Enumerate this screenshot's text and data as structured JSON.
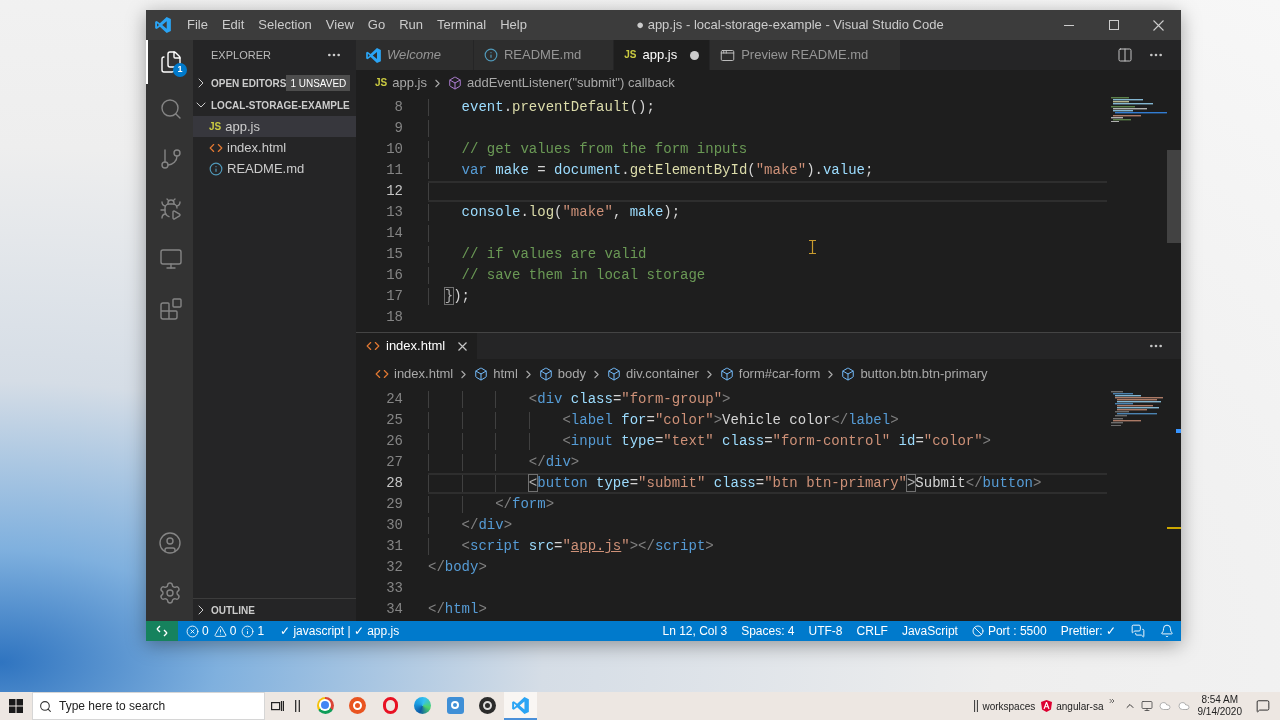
{
  "window": {
    "title": "● app.js - local-storage-example - Visual Studio Code"
  },
  "menu": [
    "File",
    "Edit",
    "Selection",
    "View",
    "Go",
    "Run",
    "Terminal",
    "Help"
  ],
  "activity_bar": [
    {
      "selected": true,
      "badge": "1"
    },
    {
      "selected": false
    },
    {
      "selected": false
    },
    {
      "selected": false
    },
    {
      "selected": false
    },
    {
      "selected": false
    }
  ],
  "sidebar": {
    "title": "EXPLORER",
    "sections": [
      {
        "title": "OPEN EDITORS",
        "expanded": false,
        "badge": "1 UNSAVED"
      },
      {
        "title": "LOCAL-STORAGE-EXAMPLE",
        "expanded": true,
        "files": [
          {
            "name": "app.js",
            "kind": "js",
            "icon_text": "JS",
            "selected": true
          },
          {
            "name": "index.html",
            "kind": "html",
            "selected": false
          },
          {
            "name": "README.md",
            "kind": "info",
            "selected": false
          }
        ]
      },
      {
        "title": "OUTLINE",
        "expanded": false
      }
    ]
  },
  "editor_groups": [
    {
      "tabs": [
        {
          "label": "Welcome",
          "kind": "welcome",
          "selected": false,
          "preview": true,
          "dirty": false
        },
        {
          "label": "README.md",
          "kind": "info",
          "selected": false,
          "preview": false,
          "dirty": false
        },
        {
          "label": "app.js",
          "kind": "js",
          "icon_text": "JS",
          "selected": true,
          "preview": false,
          "dirty": true
        },
        {
          "label": "Preview README.md",
          "kind": "preview",
          "selected": false,
          "preview": false,
          "dirty": false
        }
      ],
      "breadcrumb": [
        {
          "label": "app.js",
          "kind": "js",
          "icon_text": "JS"
        },
        {
          "label": "addEventListener(\"submit\") callback",
          "kind": "symbol"
        }
      ],
      "lines": [
        {
          "number": "8",
          "current": false,
          "tokens": [
            {
              "text": "    event",
              "kind": "variable"
            },
            {
              "text": ".",
              "kind": "punct"
            },
            {
              "text": "preventDefault",
              "kind": "function"
            },
            {
              "text": "();",
              "kind": "punct"
            }
          ]
        },
        {
          "number": "9",
          "current": false
        },
        {
          "number": "10",
          "current": false,
          "tokens": [
            {
              "text": "    // get values from the form inputs",
              "kind": "comment"
            }
          ]
        },
        {
          "number": "11",
          "current": false,
          "tokens": [
            {
              "text": "    var",
              "kind": "keyword"
            },
            {
              "text": " make",
              "kind": "variable"
            },
            {
              "text": " = ",
              "kind": "punct"
            },
            {
              "text": "document",
              "kind": "variable"
            },
            {
              "text": ".",
              "kind": "punct"
            },
            {
              "text": "getElementById",
              "kind": "function"
            },
            {
              "text": "(",
              "kind": "punct"
            },
            {
              "text": "\"make\"",
              "kind": "string"
            },
            {
              "text": ").",
              "kind": "punct"
            },
            {
              "text": "value",
              "kind": "variable"
            },
            {
              "text": ";",
              "kind": "punct"
            }
          ]
        },
        {
          "number": "12",
          "current": true
        },
        {
          "number": "13",
          "current": false,
          "tokens": [
            {
              "text": "    console",
              "kind": "variable"
            },
            {
              "text": ".",
              "kind": "punct"
            },
            {
              "text": "log",
              "kind": "function"
            },
            {
              "text": "(",
              "kind": "punct"
            },
            {
              "text": "\"make\"",
              "kind": "string"
            },
            {
              "text": ", ",
              "kind": "punct"
            },
            {
              "text": "make",
              "kind": "variable"
            },
            {
              "text": ");",
              "kind": "punct"
            }
          ]
        },
        {
          "number": "14",
          "current": false
        },
        {
          "number": "15",
          "current": false,
          "tokens": [
            {
              "text": "    // if values are valid",
              "kind": "comment"
            }
          ]
        },
        {
          "number": "16",
          "current": false,
          "tokens": [
            {
              "text": "    // save them in local storage",
              "kind": "comment"
            }
          ]
        },
        {
          "number": "17",
          "current": false,
          "tokens": [
            {
              "text": "  }",
              "kind": "match"
            },
            {
              "text": ");",
              "kind": "punct"
            }
          ]
        },
        {
          "number": "18",
          "current": false
        }
      ]
    },
    {
      "tabs": [
        {
          "label": "index.html",
          "kind": "html",
          "selected": true,
          "preview": false,
          "dirty": false
        }
      ],
      "breadcrumb": [
        {
          "label": "index.html",
          "kind": "html"
        },
        {
          "label": "html",
          "kind": "element"
        },
        {
          "label": "body",
          "kind": "element"
        },
        {
          "label": "div.container",
          "kind": "element"
        },
        {
          "label": "form#car-form",
          "kind": "element"
        },
        {
          "label": "button.btn.btn-primary",
          "kind": "element"
        }
      ],
      "lines": [
        {
          "number": "24",
          "current": false,
          "tokens": [
            {
              "text": "            <",
              "kind": "bracket"
            },
            {
              "text": "div",
              "kind": "tag"
            },
            {
              "text": " class",
              "kind": "attr"
            },
            {
              "text": "=",
              "kind": "punct"
            },
            {
              "text": "\"form-group\"",
              "kind": "string"
            },
            {
              "text": ">",
              "kind": "bracket"
            }
          ]
        },
        {
          "number": "25",
          "current": false,
          "tokens": [
            {
              "text": "                <",
              "kind": "bracket"
            },
            {
              "text": "label",
              "kind": "tag"
            },
            {
              "text": " for",
              "kind": "attr"
            },
            {
              "text": "=",
              "kind": "punct"
            },
            {
              "text": "\"color\"",
              "kind": "string"
            },
            {
              "text": ">",
              "kind": "bracket"
            },
            {
              "text": "Vehicle color",
              "kind": "text"
            },
            {
              "text": "</",
              "kind": "bracket"
            },
            {
              "text": "label",
              "kind": "tag"
            },
            {
              "text": ">",
              "kind": "bracket"
            }
          ]
        },
        {
          "number": "26",
          "current": false,
          "tokens": [
            {
              "text": "                <",
              "kind": "bracket"
            },
            {
              "text": "input",
              "kind": "tag"
            },
            {
              "text": " type",
              "kind": "attr"
            },
            {
              "text": "=",
              "kind": "punct"
            },
            {
              "text": "\"text\"",
              "kind": "string"
            },
            {
              "text": " class",
              "kind": "attr"
            },
            {
              "text": "=",
              "kind": "punct"
            },
            {
              "text": "\"form-control\"",
              "kind": "string"
            },
            {
              "text": " id",
              "kind": "attr"
            },
            {
              "text": "=",
              "kind": "punct"
            },
            {
              "text": "\"color\"",
              "kind": "string"
            },
            {
              "text": ">",
              "kind": "bracket"
            }
          ]
        },
        {
          "number": "27",
          "current": false,
          "tokens": [
            {
              "text": "            </",
              "kind": "bracket"
            },
            {
              "text": "div",
              "kind": "tag"
            },
            {
              "text": ">",
              "kind": "bracket"
            }
          ]
        },
        {
          "number": "28",
          "current": true,
          "tokens": [
            {
              "text": "            <",
              "kind": "match"
            },
            {
              "text": "button",
              "kind": "tag"
            },
            {
              "text": " type",
              "kind": "attr"
            },
            {
              "text": "=",
              "kind": "punct"
            },
            {
              "text": "\"submit\"",
              "kind": "string"
            },
            {
              "text": " class",
              "kind": "attr"
            },
            {
              "text": "=",
              "kind": "punct"
            },
            {
              "text": "\"btn btn-primary\"",
              "kind": "string"
            },
            {
              "text": ">",
              "kind": "match"
            },
            {
              "text": "Submit",
              "kind": "text"
            },
            {
              "text": "</",
              "kind": "bracket"
            },
            {
              "text": "button",
              "kind": "tag"
            },
            {
              "text": ">",
              "kind": "bracket"
            }
          ]
        },
        {
          "number": "29",
          "current": false,
          "tokens": [
            {
              "text": "        </",
              "kind": "bracket"
            },
            {
              "text": "form",
              "kind": "tag"
            },
            {
              "text": ">",
              "kind": "bracket"
            }
          ]
        },
        {
          "number": "30",
          "current": false,
          "tokens": [
            {
              "text": "    </",
              "kind": "bracket"
            },
            {
              "text": "div",
              "kind": "tag"
            },
            {
              "text": ">",
              "kind": "bracket"
            }
          ]
        },
        {
          "number": "31",
          "current": false,
          "tokens": [
            {
              "text": "    <",
              "kind": "bracket"
            },
            {
              "text": "script",
              "kind": "tag"
            },
            {
              "text": " src",
              "kind": "attr"
            },
            {
              "text": "=",
              "kind": "punct"
            },
            {
              "text": "\"",
              "kind": "string"
            },
            {
              "text": "app.js",
              "kind": "link"
            },
            {
              "text": "\"",
              "kind": "string"
            },
            {
              "text": ">",
              "kind": "bracket"
            },
            {
              "text": "</",
              "kind": "bracket"
            },
            {
              "text": "script",
              "kind": "tag"
            },
            {
              "text": ">",
              "kind": "bracket"
            }
          ]
        },
        {
          "number": "32",
          "current": false,
          "tokens": [
            {
              "text": "</",
              "kind": "bracket"
            },
            {
              "text": "body",
              "kind": "tag"
            },
            {
              "text": ">",
              "kind": "bracket"
            }
          ]
        },
        {
          "number": "33",
          "current": false
        },
        {
          "number": "34",
          "current": false,
          "tokens": [
            {
              "text": "</",
              "kind": "bracket"
            },
            {
              "text": "html",
              "kind": "tag"
            },
            {
              "text": ">",
              "kind": "bracket"
            }
          ]
        }
      ]
    }
  ],
  "status_bar": {
    "problems": {
      "errors": "0",
      "warnings": "0",
      "infos": "1"
    },
    "lint": "✓ javascript | ✓ app.js",
    "items": [
      {
        "kind": "text",
        "label": "Ln 12, Col 3"
      },
      {
        "kind": "text",
        "label": "Spaces: 4"
      },
      {
        "kind": "text",
        "label": "UTF-8"
      },
      {
        "kind": "text",
        "label": "CRLF"
      },
      {
        "kind": "text",
        "label": "JavaScript"
      },
      {
        "kind": "port",
        "label": "Port : 5500"
      },
      {
        "kind": "text",
        "label": "Prettier: ✓"
      }
    ]
  },
  "taskbar": {
    "search": {
      "placeholder": "Type here to search"
    },
    "apps": [
      {
        "selected": false
      },
      {
        "selected": false
      },
      {
        "selected": false
      },
      {
        "selected": false
      },
      {
        "selected": false
      },
      {
        "selected": false
      },
      {
        "selected": true
      }
    ],
    "toolbars": [
      "workspaces",
      "angular-sa"
    ],
    "clock": {
      "time": "8:54 AM",
      "date": "9/14/2020"
    }
  }
}
